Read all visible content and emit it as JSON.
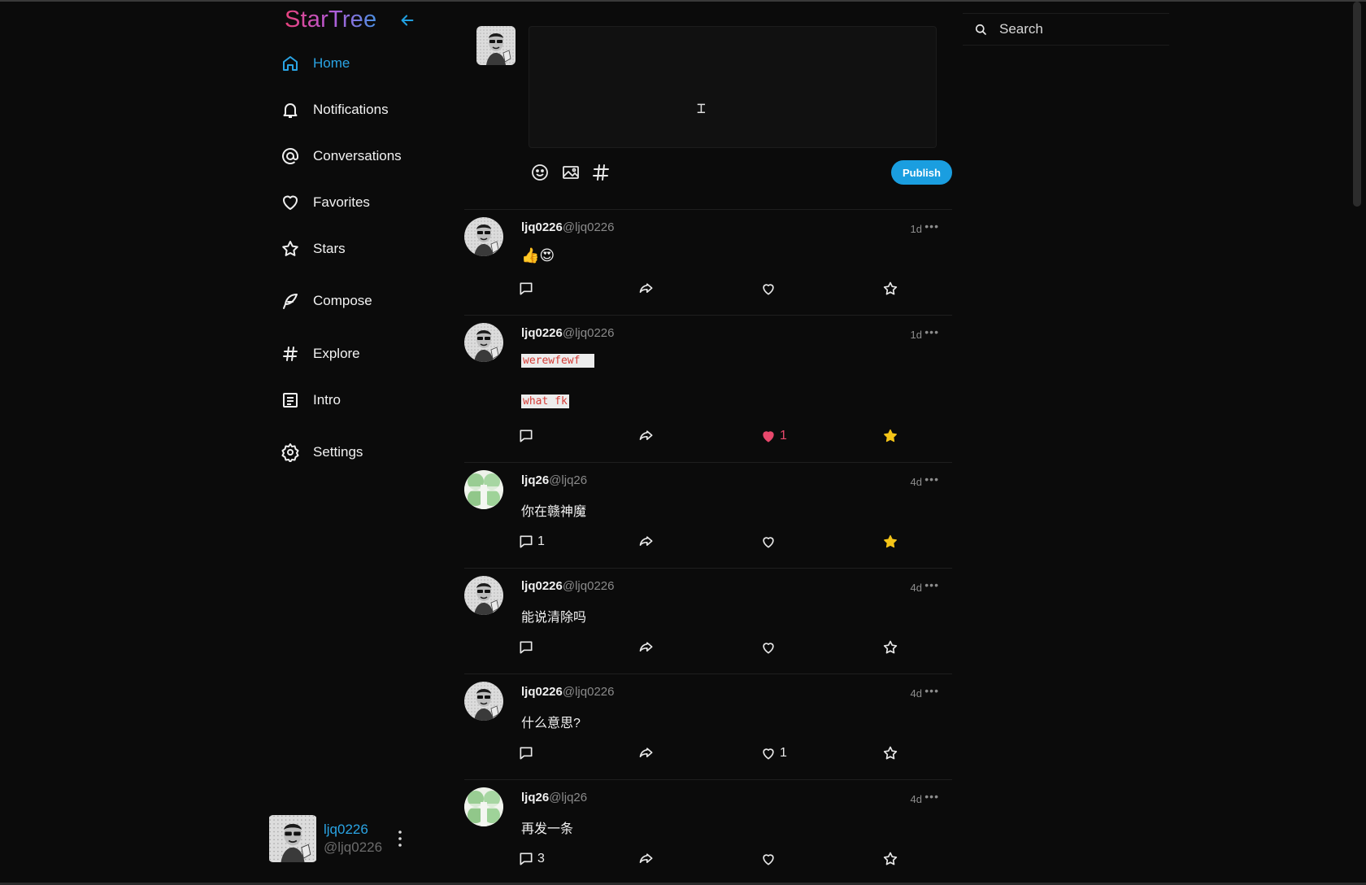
{
  "app": {
    "brand": "StarTree"
  },
  "nav": [
    {
      "label": "Home",
      "icon": "home-icon",
      "active": true
    },
    {
      "label": "Notifications",
      "icon": "bell-icon"
    },
    {
      "label": "Conversations",
      "icon": "at-icon"
    },
    {
      "label": "Favorites",
      "icon": "heart-icon"
    },
    {
      "label": "Stars",
      "icon": "star-icon"
    },
    {
      "label": "Compose",
      "icon": "feather-icon"
    },
    {
      "label": "Explore",
      "icon": "hashtag-icon"
    },
    {
      "label": "Intro",
      "icon": "document-icon"
    },
    {
      "label": "Settings",
      "icon": "gear-icon"
    }
  ],
  "current_user": {
    "name": "ljq0226",
    "handle": "@ljq0226"
  },
  "composer": {
    "publish_label": "Publish",
    "text": ""
  },
  "search": {
    "placeholder": "Search"
  },
  "colors": {
    "accent": "#1a9ee0",
    "like": "#e8486c",
    "star": "#f5c518",
    "background": "#0b0b0b"
  },
  "posts": [
    {
      "name": "ljq0226",
      "handle": "@ljq0226",
      "time": "1d",
      "body": "👍😍",
      "comments": "",
      "likes": "",
      "liked": false,
      "starred": false
    },
    {
      "name": "ljq0226",
      "handle": "@ljq0226",
      "time": "1d",
      "code1": "werewfewf  ",
      "code2": "what fk",
      "comments": "",
      "likes": "1",
      "liked": true,
      "starred": true
    },
    {
      "name": "ljq26",
      "handle": "@ljq26",
      "time": "4d",
      "body": "你在赣神魔",
      "comments": "1",
      "likes": "",
      "liked": false,
      "starred": true
    },
    {
      "name": "ljq0226",
      "handle": "@ljq0226",
      "time": "4d",
      "body": "能说清除吗",
      "comments": "",
      "likes": "",
      "liked": false,
      "starred": false
    },
    {
      "name": "ljq0226",
      "handle": "@ljq0226",
      "time": "4d",
      "body": "什么意思?",
      "comments": "",
      "likes": "1",
      "liked": false,
      "starred": false
    },
    {
      "name": "ljq26",
      "handle": "@ljq26",
      "time": "4d",
      "body": "再发一条",
      "comments": "3",
      "likes": "",
      "liked": false,
      "starred": false
    }
  ]
}
